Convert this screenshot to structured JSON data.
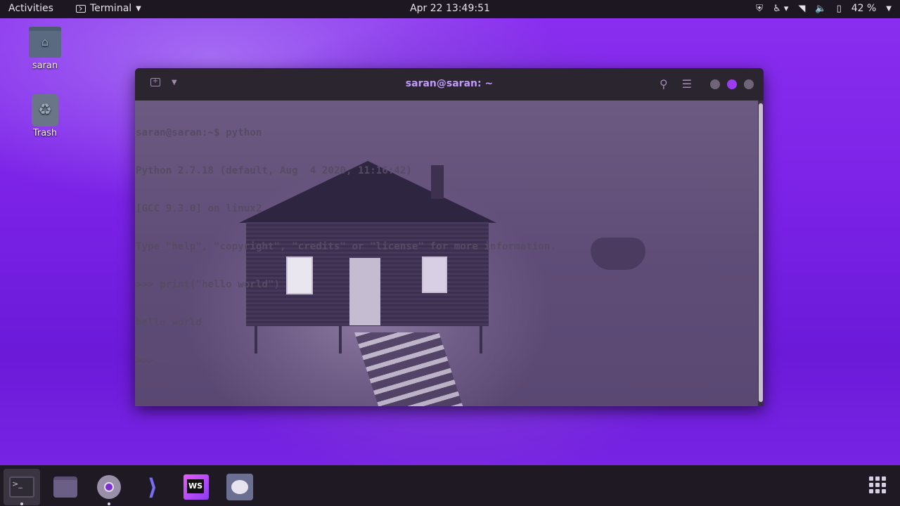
{
  "topbar": {
    "activities": "Activities",
    "app_name": "Terminal",
    "clock": "Apr 22  13:49:51",
    "battery": "42 %"
  },
  "desktop": {
    "icons": [
      {
        "label": "saran",
        "icon": "home-folder-icon"
      },
      {
        "label": "Trash",
        "icon": "trash-icon"
      }
    ]
  },
  "window": {
    "title": "saran@saran: ~",
    "lines": [
      "saran@saran:~$ python",
      "Python 2.7.18 (default, Aug  4 2020, 11:16:42)",
      "[GCC 9.3.0] on linux2",
      "Type \"help\", \"copyright\", \"credits\" or \"license\" for more information.",
      ">>> print(\"hello world\")",
      "hello world",
      ">>> _"
    ]
  },
  "dock": {
    "items": [
      "terminal-icon",
      "files-icon",
      "chrome-icon",
      "vscode-icon",
      "webstorm-icon",
      "teamviewer-icon"
    ],
    "apps_grid": "show-applications-icon"
  }
}
